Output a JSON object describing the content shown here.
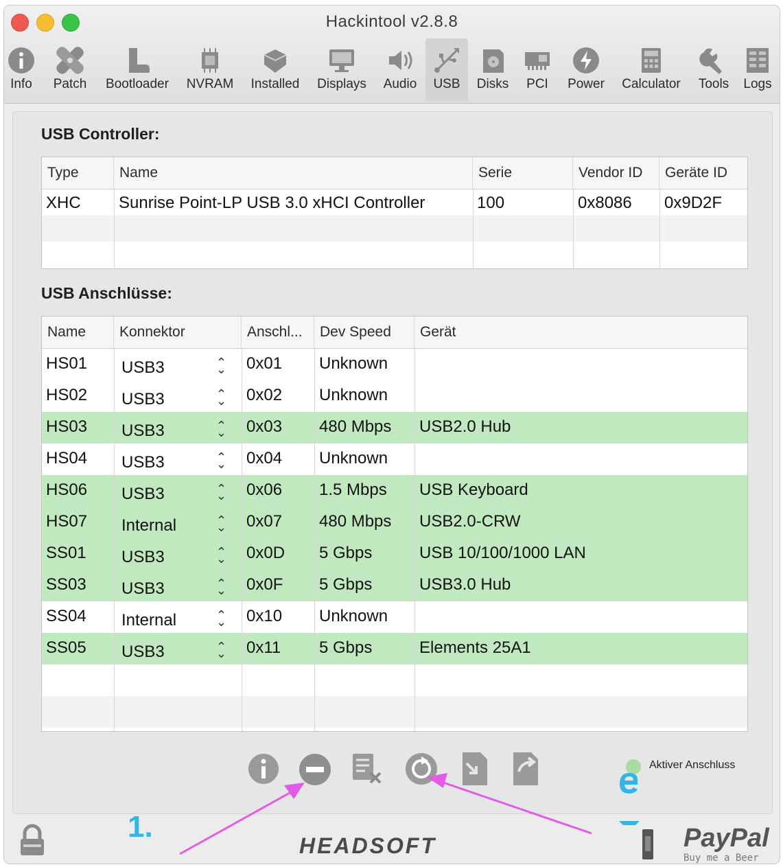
{
  "window": {
    "title": "Hackintool v2.8.8"
  },
  "toolbar": {
    "items": [
      {
        "label": "Info",
        "icon": "info-icon"
      },
      {
        "label": "Patch",
        "icon": "patch-icon"
      },
      {
        "label": "Bootloader",
        "icon": "boot-icon"
      },
      {
        "label": "NVRAM",
        "icon": "chip-icon"
      },
      {
        "label": "Installed",
        "icon": "installed-icon"
      },
      {
        "label": "Displays",
        "icon": "display-icon"
      },
      {
        "label": "Audio",
        "icon": "speaker-icon"
      },
      {
        "label": "USB",
        "icon": "usb-icon",
        "active": true
      },
      {
        "label": "Disks",
        "icon": "disk-icon"
      },
      {
        "label": "PCI",
        "icon": "pci-icon"
      },
      {
        "label": "Power",
        "icon": "power-icon"
      },
      {
        "label": "Calculator",
        "icon": "calculator-icon"
      },
      {
        "label": "Tools",
        "icon": "tools-icon"
      },
      {
        "label": "Logs",
        "icon": "logs-icon"
      }
    ]
  },
  "controller": {
    "title": "USB Controller:",
    "columns": [
      "Type",
      "Name",
      "Serie",
      "Vendor ID",
      "Geräte ID"
    ],
    "rows": [
      [
        "XHC",
        "Sunrise Point-LP USB 3.0 xHCI Controller",
        "100",
        "0x8086",
        "0x9D2F"
      ]
    ]
  },
  "ports": {
    "title": "USB Anschlüsse:",
    "columns": [
      "Name",
      "Konnektor",
      "Anschl...",
      "Dev Speed",
      "Gerät"
    ],
    "rows": [
      {
        "name": "HS01",
        "connector": "USB3",
        "port": "0x01",
        "speed": "Unknown",
        "device": "",
        "active": false
      },
      {
        "name": "HS02",
        "connector": "USB3",
        "port": "0x02",
        "speed": "Unknown",
        "device": "",
        "active": false
      },
      {
        "name": "HS03",
        "connector": "USB3",
        "port": "0x03",
        "speed": "480 Mbps",
        "device": "USB2.0 Hub",
        "active": true
      },
      {
        "name": "HS04",
        "connector": "USB3",
        "port": "0x04",
        "speed": "Unknown",
        "device": "",
        "active": false
      },
      {
        "name": "HS06",
        "connector": "USB3",
        "port": "0x06",
        "speed": "1.5 Mbps",
        "device": "USB Keyboard",
        "active": true
      },
      {
        "name": "HS07",
        "connector": "Internal",
        "port": "0x07",
        "speed": "480 Mbps",
        "device": "USB2.0-CRW",
        "active": true
      },
      {
        "name": "SS01",
        "connector": "USB3",
        "port": "0x0D",
        "speed": "5 Gbps",
        "device": "USB 10/100/1000 LAN",
        "active": true
      },
      {
        "name": "SS03",
        "connector": "USB3",
        "port": "0x0F",
        "speed": "5 Gbps",
        "device": "USB3.0 Hub",
        "active": true
      },
      {
        "name": "SS04",
        "connector": "Internal",
        "port": "0x10",
        "speed": "Unknown",
        "device": "",
        "active": false
      },
      {
        "name": "SS05",
        "connector": "USB3",
        "port": "0x11",
        "speed": "5 Gbps",
        "device": "Elements 25A1",
        "active": true
      }
    ]
  },
  "legend": {
    "label": "Aktiver Anschluss",
    "color": "#a7dca0"
  },
  "annotation": {
    "label": "1.",
    "arrow_color": "#e15be6"
  },
  "footer": {
    "brand": "HEADSOFT",
    "paypal": "PayPal",
    "paypal_sub": "Buy me a Beer"
  },
  "colors": {
    "active_row": "#c0e9c0",
    "accent_blue": "#31b6e8"
  }
}
